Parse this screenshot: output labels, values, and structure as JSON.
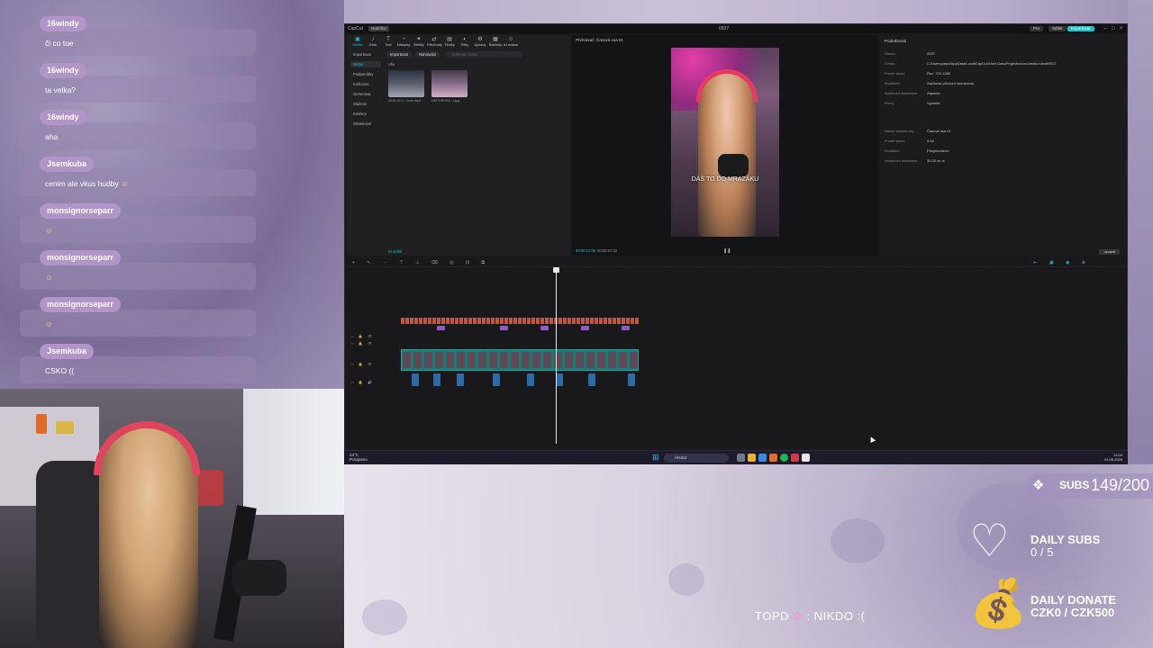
{
  "chat": {
    "messages": [
      {
        "user": "16windy",
        "text": "či co toe",
        "emote": false
      },
      {
        "user": "16windy",
        "text": "ta velka?",
        "emote": false
      },
      {
        "user": "16windy",
        "text": "aha",
        "emote": false
      },
      {
        "user": "Jsemkuba",
        "text": "cenim ale vkus hudby",
        "emote": true
      },
      {
        "user": "monsignorseparr",
        "text": "",
        "emote": true
      },
      {
        "user": "monsignorseparr",
        "text": "",
        "emote": true
      },
      {
        "user": "monsignorseparr",
        "text": "",
        "emote": true
      },
      {
        "user": "Jsemkuba",
        "text": "CSKO ((",
        "emote": false
      }
    ]
  },
  "editor": {
    "brand": "CapCut",
    "menu": "Nabídka",
    "title": "0927",
    "pro_label": "Pro",
    "share_label": "Sdílet",
    "export_label": "Exportovat",
    "toolbar": [
      "Média",
      "Zvuk",
      "Text",
      "Nálepky",
      "Efekty",
      "Přechody",
      "Titulky",
      "Filtry",
      "Úpravy",
      "Šablony",
      "AI avatar"
    ],
    "media_side": [
      "Importovat",
      "Místní",
      "Podporobky",
      "Knihovna",
      "Generovat",
      "Stažené",
      "Kolekce",
      "Streemové"
    ],
    "chips": [
      "Importovat",
      "Nahrávání"
    ],
    "search_placeholder": "Vyhledat média",
    "section_label": "Vše",
    "files": [
      "2026-01-2...bum.mp4",
      "REPOSHR1...r.jpg"
    ],
    "ai_label": "AI unifié",
    "player_title": "Přehrávač: Časová osa 01",
    "subtitle": "DÁŠ TO DO MRAZÁKU",
    "player_time_current": "00:00:21:06",
    "player_time_total": "00:00:57:22",
    "details_title": "Podrobnosti",
    "details": [
      {
        "label": "Název:",
        "value": "0927"
      },
      {
        "label": "Cesta:",
        "value": "C:/Users/pepa/AppData/Local/CapCut/User Data/Projects/com.lveditor.draft/0927"
      },
      {
        "label": "Poměr stran:",
        "value": "Řez: 720 1280"
      },
      {
        "label": "Rozlišení:",
        "value": "Zachovat původní snímkovou"
      },
      {
        "label": "Snímková frekvence:",
        "value": "Zapnuto"
      },
      {
        "label": "Proxy:",
        "value": "Vypnuto"
      },
      {
        "label": "Název časové osy:",
        "value": "Časová osa 01"
      },
      {
        "label": "Poměr stran:",
        "value": "9:16"
      },
      {
        "label": "Rozlišení:",
        "value": "Přizpůsobeno"
      },
      {
        "label": "Snímková frekvence:",
        "value": "30.00 sn./s"
      }
    ],
    "modify_label": "Upravit"
  },
  "taskbar": {
    "weather_temp": "24°C",
    "weather_desc": "Polojasno",
    "search_placeholder": "Hledat",
    "time": "12:04",
    "date": "24.06.2026"
  },
  "widgets": {
    "subs_label": "SUBS",
    "subs_value": "149/200",
    "daily_subs_label": "DAILY SUBS",
    "daily_subs_value": "0 / 5",
    "daily_donate_label": "DAILY DONATE",
    "daily_donate_value": "CZK0 / CZK500",
    "top_donor": "TOPD",
    "top_donor_value": ": NIKDO :("
  },
  "colors": {
    "accent": "#18c3c9",
    "chat_user": "#b194c8",
    "overlay_purple": "#9d90b8",
    "clip_subtitle": "#c0583f",
    "clip_video": "#177c77",
    "clip_audio": "#2b6ca8"
  }
}
